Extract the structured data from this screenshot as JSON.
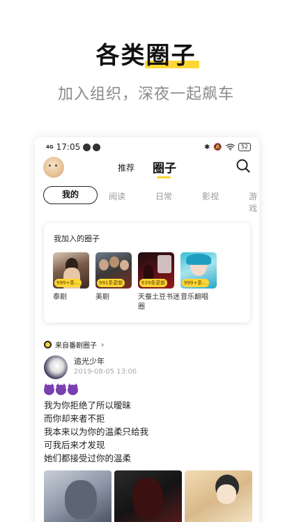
{
  "promo": {
    "title": "各类圈子",
    "subtitle": "加入组织，深夜一起飙车"
  },
  "status_bar": {
    "network": "4G",
    "time": "17:05",
    "battery": "52"
  },
  "top_nav": {
    "tabs": [
      {
        "label": "推荐",
        "active": false
      },
      {
        "label": "圈子",
        "active": true
      }
    ]
  },
  "categories": [
    {
      "label": "我的",
      "active": true
    },
    {
      "label": "阅读",
      "active": false
    },
    {
      "label": "日常",
      "active": false
    },
    {
      "label": "影视",
      "active": false
    },
    {
      "label": "游戏",
      "active": false
    }
  ],
  "joined": {
    "title": "我加入的圈子",
    "circles": [
      {
        "name": "泰剧",
        "badge": "999+条…"
      },
      {
        "name": "美剧",
        "badge": "991条更新"
      },
      {
        "name": "天蚕土豆书迷圈",
        "badge": "639条更新"
      },
      {
        "name": "音乐翻唱",
        "badge": "999+条…"
      }
    ]
  },
  "post": {
    "source": "来自番剧圈子",
    "author": "追光少年",
    "time": "2019-08-05 13:06",
    "lines": [
      "我为你拒绝了所以暧昧",
      "而你却来者不拒",
      "我本来以为你的温柔只给我",
      "可我后来才发现",
      "她们都接受过你的温柔"
    ]
  },
  "colors": {
    "accent": "#ffd633",
    "emoji": "#7a3fb0"
  }
}
